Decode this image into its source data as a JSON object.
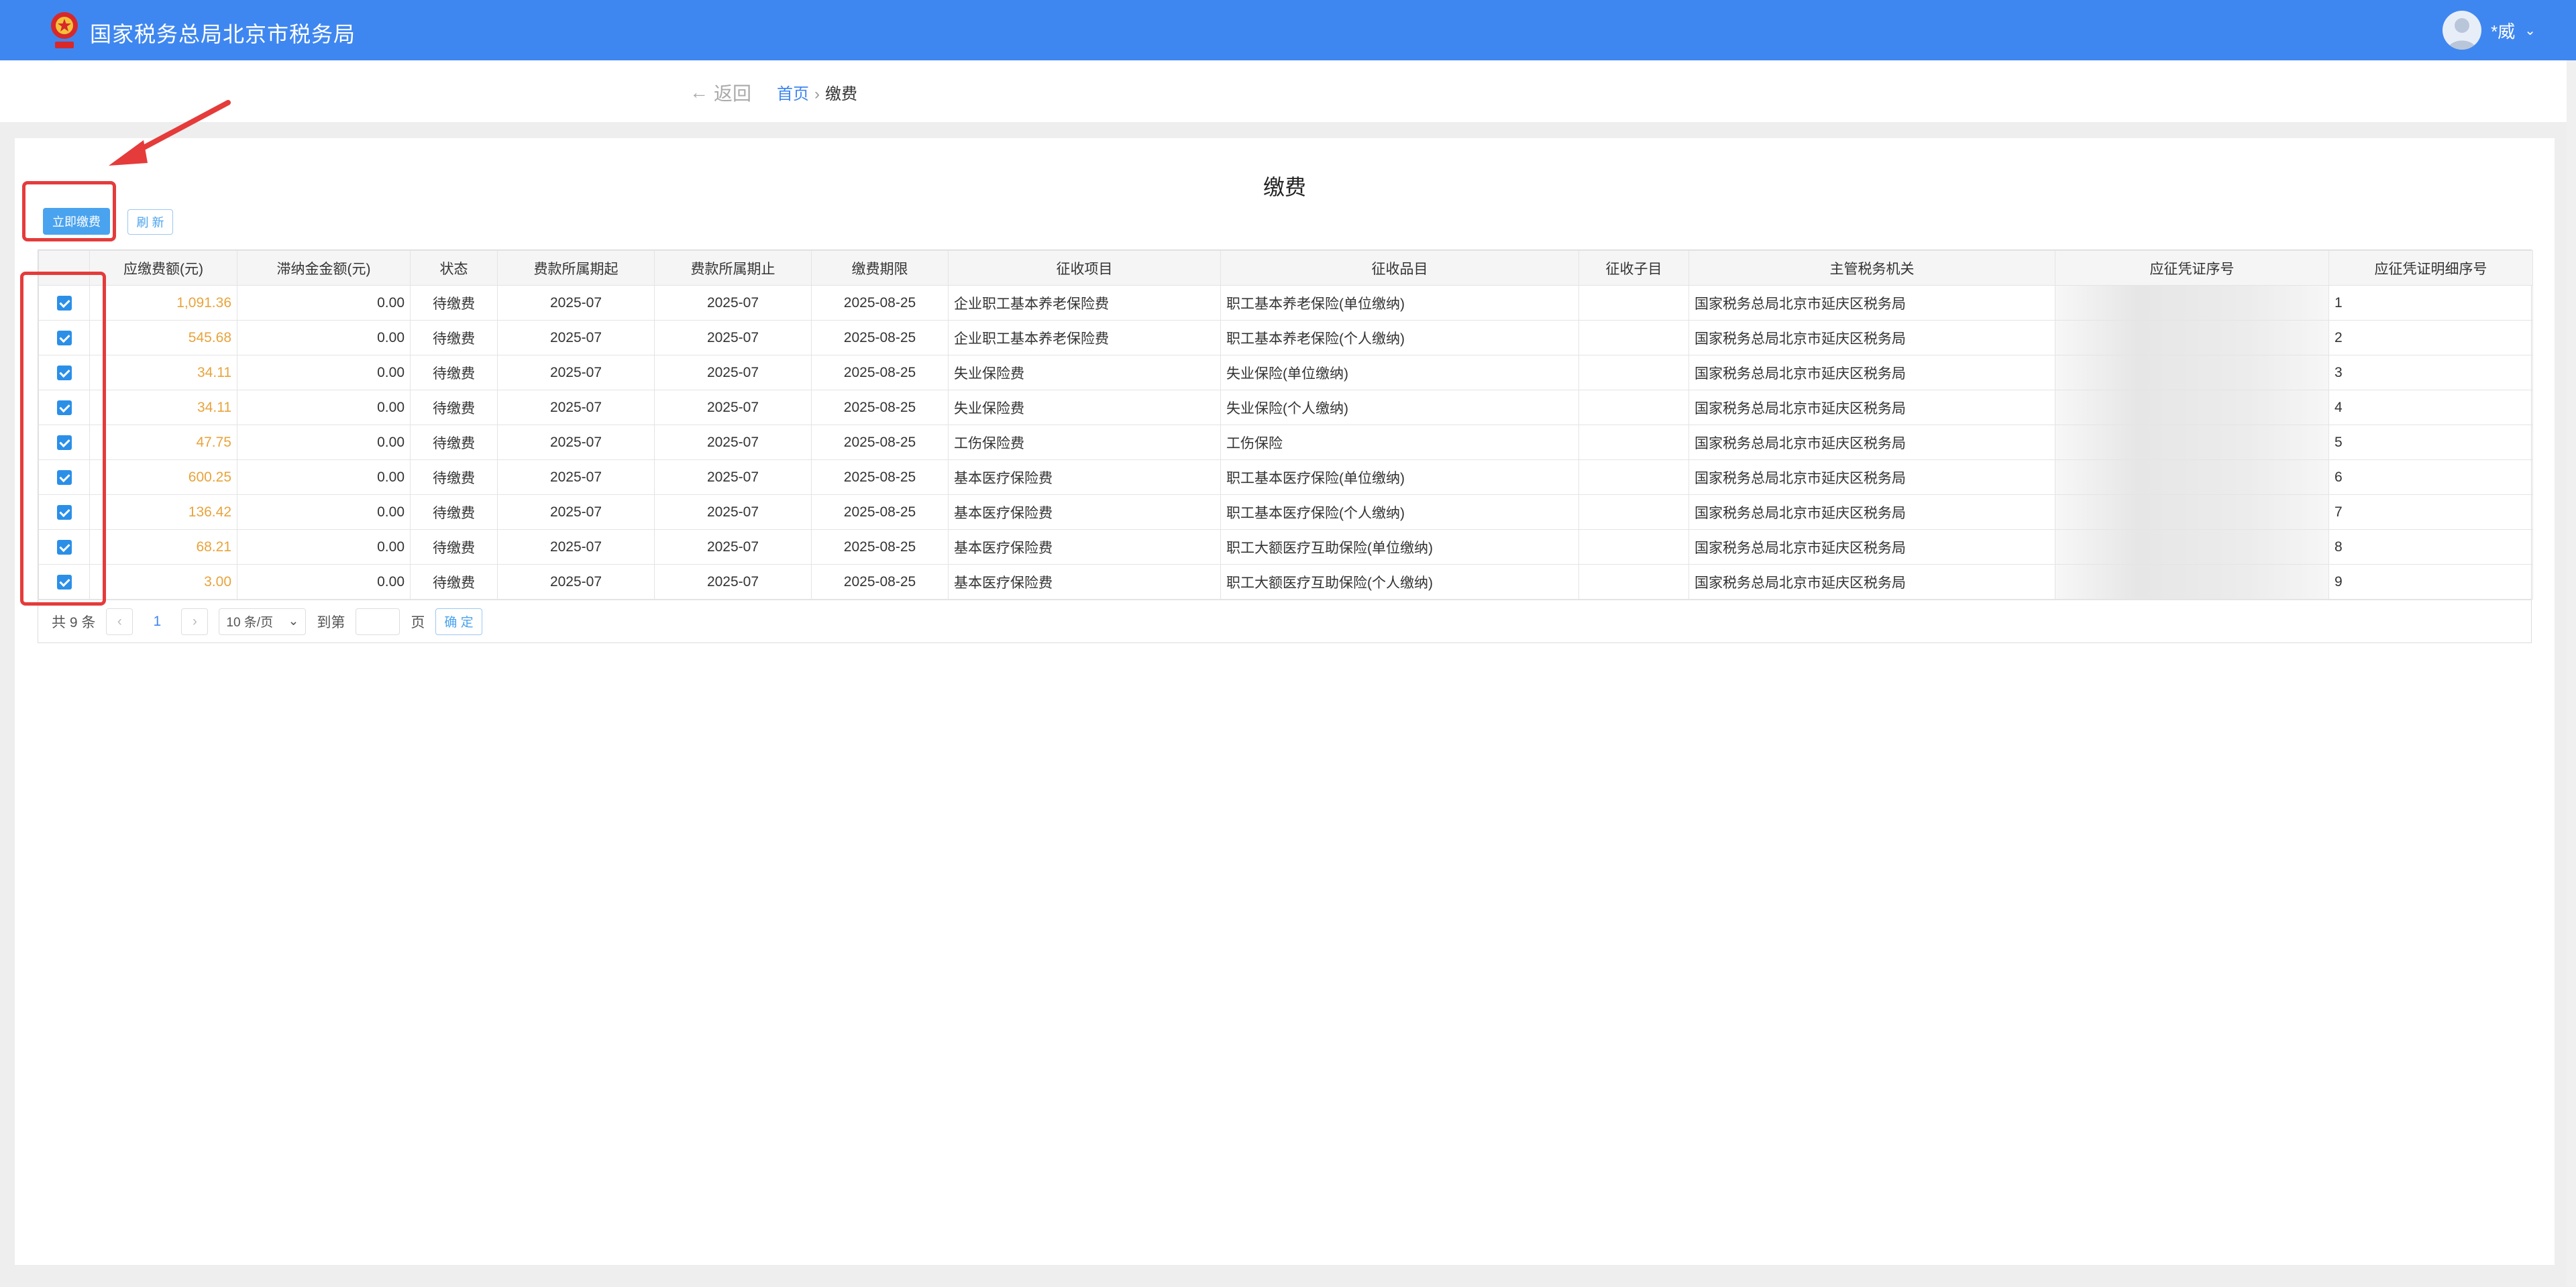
{
  "header": {
    "title": "国家税务总局北京市税务局",
    "user_name": "*威",
    "logo_icon": "tax-emblem-icon",
    "brand_color": "#3f87f0"
  },
  "subnav": {
    "back_label": "返回",
    "breadcrumb": {
      "home": "首页",
      "separator": "›",
      "current": "缴费"
    }
  },
  "page": {
    "title": "缴费",
    "pay_button": "立即缴费",
    "refresh_button": "刷 新"
  },
  "table": {
    "columns": [
      "应缴费额(元)",
      "滞纳金金额(元)",
      "状态",
      "费款所属期起",
      "费款所属期止",
      "缴费期限",
      "征收项目",
      "征收品目",
      "征收子目",
      "主管税务机关",
      "应征凭证序号",
      "应征凭证明细序号"
    ],
    "rows": [
      {
        "checked": true,
        "amount": "1,091.36",
        "late_fee": "0.00",
        "status": "待缴费",
        "start": "2025-07",
        "end": "2025-07",
        "deadline": "2025-08-25",
        "item": "企业职工基本养老保险费",
        "subitem": "职工基本养老保险(单位缴纳)",
        "subcat": "",
        "office": "国家税务总局北京市延庆区税务局",
        "voucher": "",
        "detail_no": "1"
      },
      {
        "checked": true,
        "amount": "545.68",
        "late_fee": "0.00",
        "status": "待缴费",
        "start": "2025-07",
        "end": "2025-07",
        "deadline": "2025-08-25",
        "item": "企业职工基本养老保险费",
        "subitem": "职工基本养老保险(个人缴纳)",
        "subcat": "",
        "office": "国家税务总局北京市延庆区税务局",
        "voucher": "",
        "detail_no": "2"
      },
      {
        "checked": true,
        "amount": "34.11",
        "late_fee": "0.00",
        "status": "待缴费",
        "start": "2025-07",
        "end": "2025-07",
        "deadline": "2025-08-25",
        "item": "失业保险费",
        "subitem": "失业保险(单位缴纳)",
        "subcat": "",
        "office": "国家税务总局北京市延庆区税务局",
        "voucher": "",
        "detail_no": "3"
      },
      {
        "checked": true,
        "amount": "34.11",
        "late_fee": "0.00",
        "status": "待缴费",
        "start": "2025-07",
        "end": "2025-07",
        "deadline": "2025-08-25",
        "item": "失业保险费",
        "subitem": "失业保险(个人缴纳)",
        "subcat": "",
        "office": "国家税务总局北京市延庆区税务局",
        "voucher": "",
        "detail_no": "4"
      },
      {
        "checked": true,
        "amount": "47.75",
        "late_fee": "0.00",
        "status": "待缴费",
        "start": "2025-07",
        "end": "2025-07",
        "deadline": "2025-08-25",
        "item": "工伤保险费",
        "subitem": "工伤保险",
        "subcat": "",
        "office": "国家税务总局北京市延庆区税务局",
        "voucher": "",
        "detail_no": "5"
      },
      {
        "checked": true,
        "amount": "600.25",
        "late_fee": "0.00",
        "status": "待缴费",
        "start": "2025-07",
        "end": "2025-07",
        "deadline": "2025-08-25",
        "item": "基本医疗保险费",
        "subitem": "职工基本医疗保险(单位缴纳)",
        "subcat": "",
        "office": "国家税务总局北京市延庆区税务局",
        "voucher": "",
        "detail_no": "6"
      },
      {
        "checked": true,
        "amount": "136.42",
        "late_fee": "0.00",
        "status": "待缴费",
        "start": "2025-07",
        "end": "2025-07",
        "deadline": "2025-08-25",
        "item": "基本医疗保险费",
        "subitem": "职工基本医疗保险(个人缴纳)",
        "subcat": "",
        "office": "国家税务总局北京市延庆区税务局",
        "voucher": "",
        "detail_no": "7"
      },
      {
        "checked": true,
        "amount": "68.21",
        "late_fee": "0.00",
        "status": "待缴费",
        "start": "2025-07",
        "end": "2025-07",
        "deadline": "2025-08-25",
        "item": "基本医疗保险费",
        "subitem": "职工大额医疗互助保险(单位缴纳)",
        "subcat": "",
        "office": "国家税务总局北京市延庆区税务局",
        "voucher": "",
        "detail_no": "8"
      },
      {
        "checked": true,
        "amount": "3.00",
        "late_fee": "0.00",
        "status": "待缴费",
        "start": "2025-07",
        "end": "2025-07",
        "deadline": "2025-08-25",
        "item": "基本医疗保险费",
        "subitem": "职工大额医疗互助保险(个人缴纳)",
        "subcat": "",
        "office": "国家税务总局北京市延庆区税务局",
        "voucher": "",
        "detail_no": "9"
      }
    ]
  },
  "pager": {
    "total_prefix": "共",
    "total": "9",
    "total_suffix": "条",
    "current_page": "1",
    "page_size": "10 条/页",
    "goto_prefix": "到第",
    "goto_suffix": "页",
    "confirm": "确 定"
  },
  "annotations": {
    "color": "#e53b3b",
    "arrow_icon": "red-arrow-icon"
  }
}
